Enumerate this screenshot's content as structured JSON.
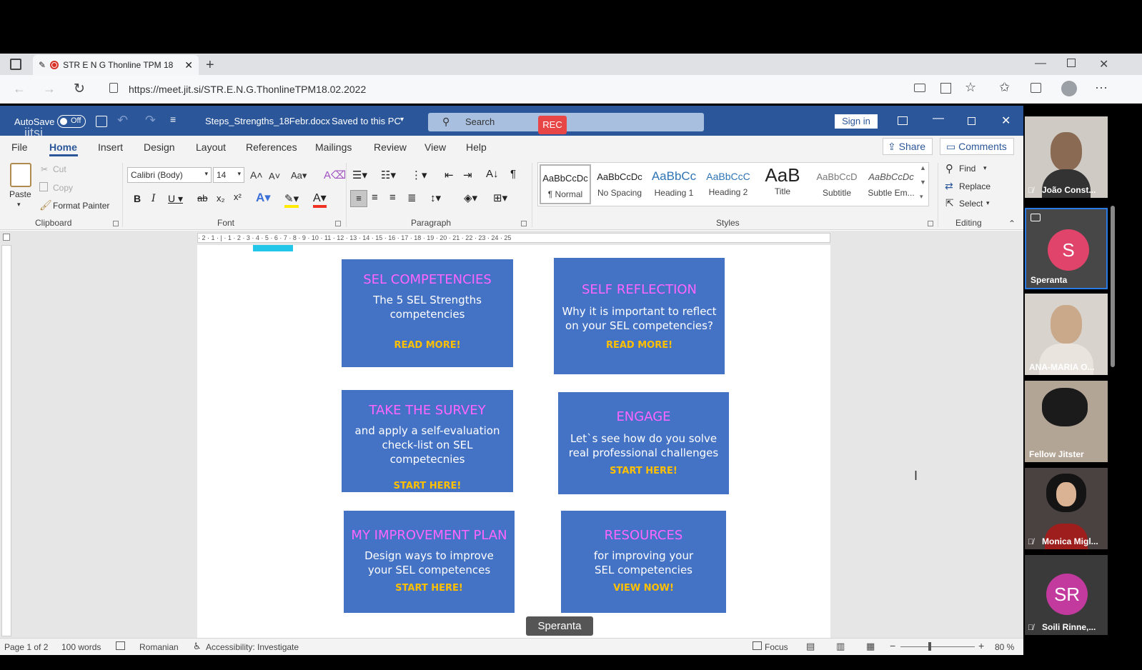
{
  "browser": {
    "tab_title": "STR E N G Thonline TPM 18",
    "url": "https://meet.jit.si/STR.E.N.G.ThonlineTPM18.02.2022"
  },
  "word": {
    "autosave_label": "AutoSave",
    "autosave_state": "Off",
    "filename": "Steps_Strengths_18Febr.docx",
    "save_status": "Saved to this PC",
    "search_placeholder": "Search",
    "rec_badge": "REC",
    "sign_in": "Sign in",
    "jitsi_watermark": "jitsi",
    "tabs": [
      "File",
      "Home",
      "Insert",
      "Design",
      "Layout",
      "References",
      "Mailings",
      "Review",
      "View",
      "Help"
    ],
    "share": "Share",
    "comments": "Comments",
    "clipboard": {
      "paste": "Paste",
      "cut": "Cut",
      "copy": "Copy",
      "format_painter": "Format Painter",
      "label": "Clipboard"
    },
    "font": {
      "name": "Calibri (Body)",
      "size": "14",
      "label": "Font"
    },
    "paragraph_label": "Paragraph",
    "styles": [
      {
        "preview": "AaBbCcDc",
        "name": "¶ Normal"
      },
      {
        "preview": "AaBbCcDc",
        "name": "No Spacing"
      },
      {
        "preview": "AaBbCc",
        "name": "Heading 1"
      },
      {
        "preview": "AaBbCcC",
        "name": "Heading 2"
      },
      {
        "preview": "AaB",
        "name": "Title"
      },
      {
        "preview": "AaBbCcD",
        "name": "Subtitle"
      },
      {
        "preview": "AaBbCcDc",
        "name": "Subtle Em..."
      }
    ],
    "styles_label": "Styles",
    "editing": {
      "find": "Find",
      "replace": "Replace",
      "select": "Select",
      "label": "Editing"
    },
    "ruler": "· 2 · 1 · | · 1 · 2 · 3 · 4 · 5 · 6 · 7 · 8 · 9 · 10 · 11 · 12 · 13 · 14 · 15 · 16 · 17 · 18 · 19 · 20 · 21 · 22 · 23 · 24 · 25",
    "cards": [
      {
        "title": "SEL COMPETENCIES",
        "body": "The 5 SEL Strengths competencies",
        "link": "READ MORE!"
      },
      {
        "title": "SELF REFLECTION",
        "body": "Why it is important to reflect on your SEL competencies?",
        "link": "READ MORE!"
      },
      {
        "title": "TAKE THE SURVEY",
        "body": "and apply a self-evaluation check-list on SEL competecnies",
        "link": "START HERE!"
      },
      {
        "title": "ENGAGE",
        "body": "Let`s see how do you solve real professional challenges",
        "link": "START HERE!"
      },
      {
        "title": "MY IMPROVEMENT PLAN",
        "body": "Design ways to improve your SEL competences",
        "link": "START HERE!"
      },
      {
        "title": "RESOURCES",
        "body": "for improving your SEL competencies",
        "link": "VIEW NOW!"
      }
    ],
    "status": {
      "page": "Page 1 of 2",
      "words": "100 words",
      "language": "Romanian",
      "accessibility": "Accessibility: Investigate",
      "focus": "Focus",
      "zoom": "80 %"
    }
  },
  "jitsi": {
    "speaker_label": "Speranta",
    "participants": [
      {
        "name": "João Const...",
        "type": "video"
      },
      {
        "name": "Speranta",
        "type": "avatar",
        "initials": "S",
        "color": "#e0446a"
      },
      {
        "name": "ANA-MARIA O...",
        "type": "video"
      },
      {
        "name": "Fellow Jitster",
        "type": "video"
      },
      {
        "name": "Monica Migl...",
        "type": "video"
      },
      {
        "name": "Soili Rinne,...",
        "type": "avatar",
        "initials": "SR",
        "color": "#c33a9e"
      }
    ]
  }
}
